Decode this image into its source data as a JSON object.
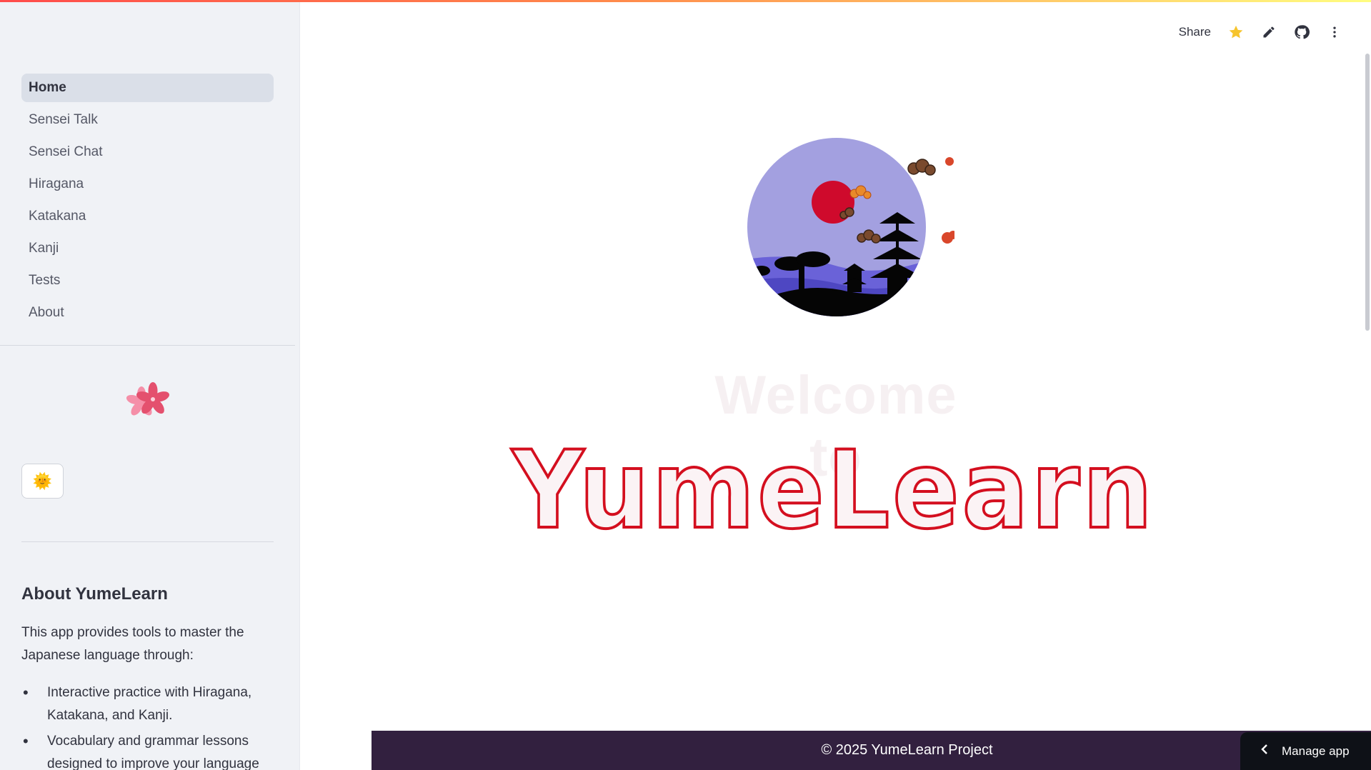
{
  "sidebar": {
    "nav_items": [
      {
        "label": "Home",
        "active": true
      },
      {
        "label": "Sensei Talk",
        "active": false
      },
      {
        "label": "Sensei Chat",
        "active": false
      },
      {
        "label": "Hiragana",
        "active": false
      },
      {
        "label": "Katakana",
        "active": false
      },
      {
        "label": "Kanji",
        "active": false
      },
      {
        "label": "Tests",
        "active": false
      },
      {
        "label": "About",
        "active": false
      }
    ],
    "theme_button_icon": "🌞",
    "about": {
      "title": "About YumeLearn",
      "text": "This app provides tools to master the Japanese language through:",
      "items": [
        "Interactive practice with Hiragana, Katakana, and Kanji.",
        "Vocabulary and grammar lessons designed to improve your language"
      ]
    }
  },
  "header": {
    "share_label": "Share",
    "icons": [
      "star-icon",
      "pencil-icon",
      "github-icon",
      "more-vertical-icon"
    ]
  },
  "main": {
    "welcome_text": "Welcome to",
    "logo_text": "YumeLearn"
  },
  "footer": {
    "copyright": "© 2025 YumeLearn Project",
    "manage_app_label": "Manage app"
  },
  "colors": {
    "accent": "#ff4b4b",
    "logo_red": "#d40f1f",
    "footer_bg": "#32203f",
    "sidebar_bg": "#f0f2f6",
    "emblem_sky": "#a3a0e0",
    "sun": "#cf0a2c"
  }
}
